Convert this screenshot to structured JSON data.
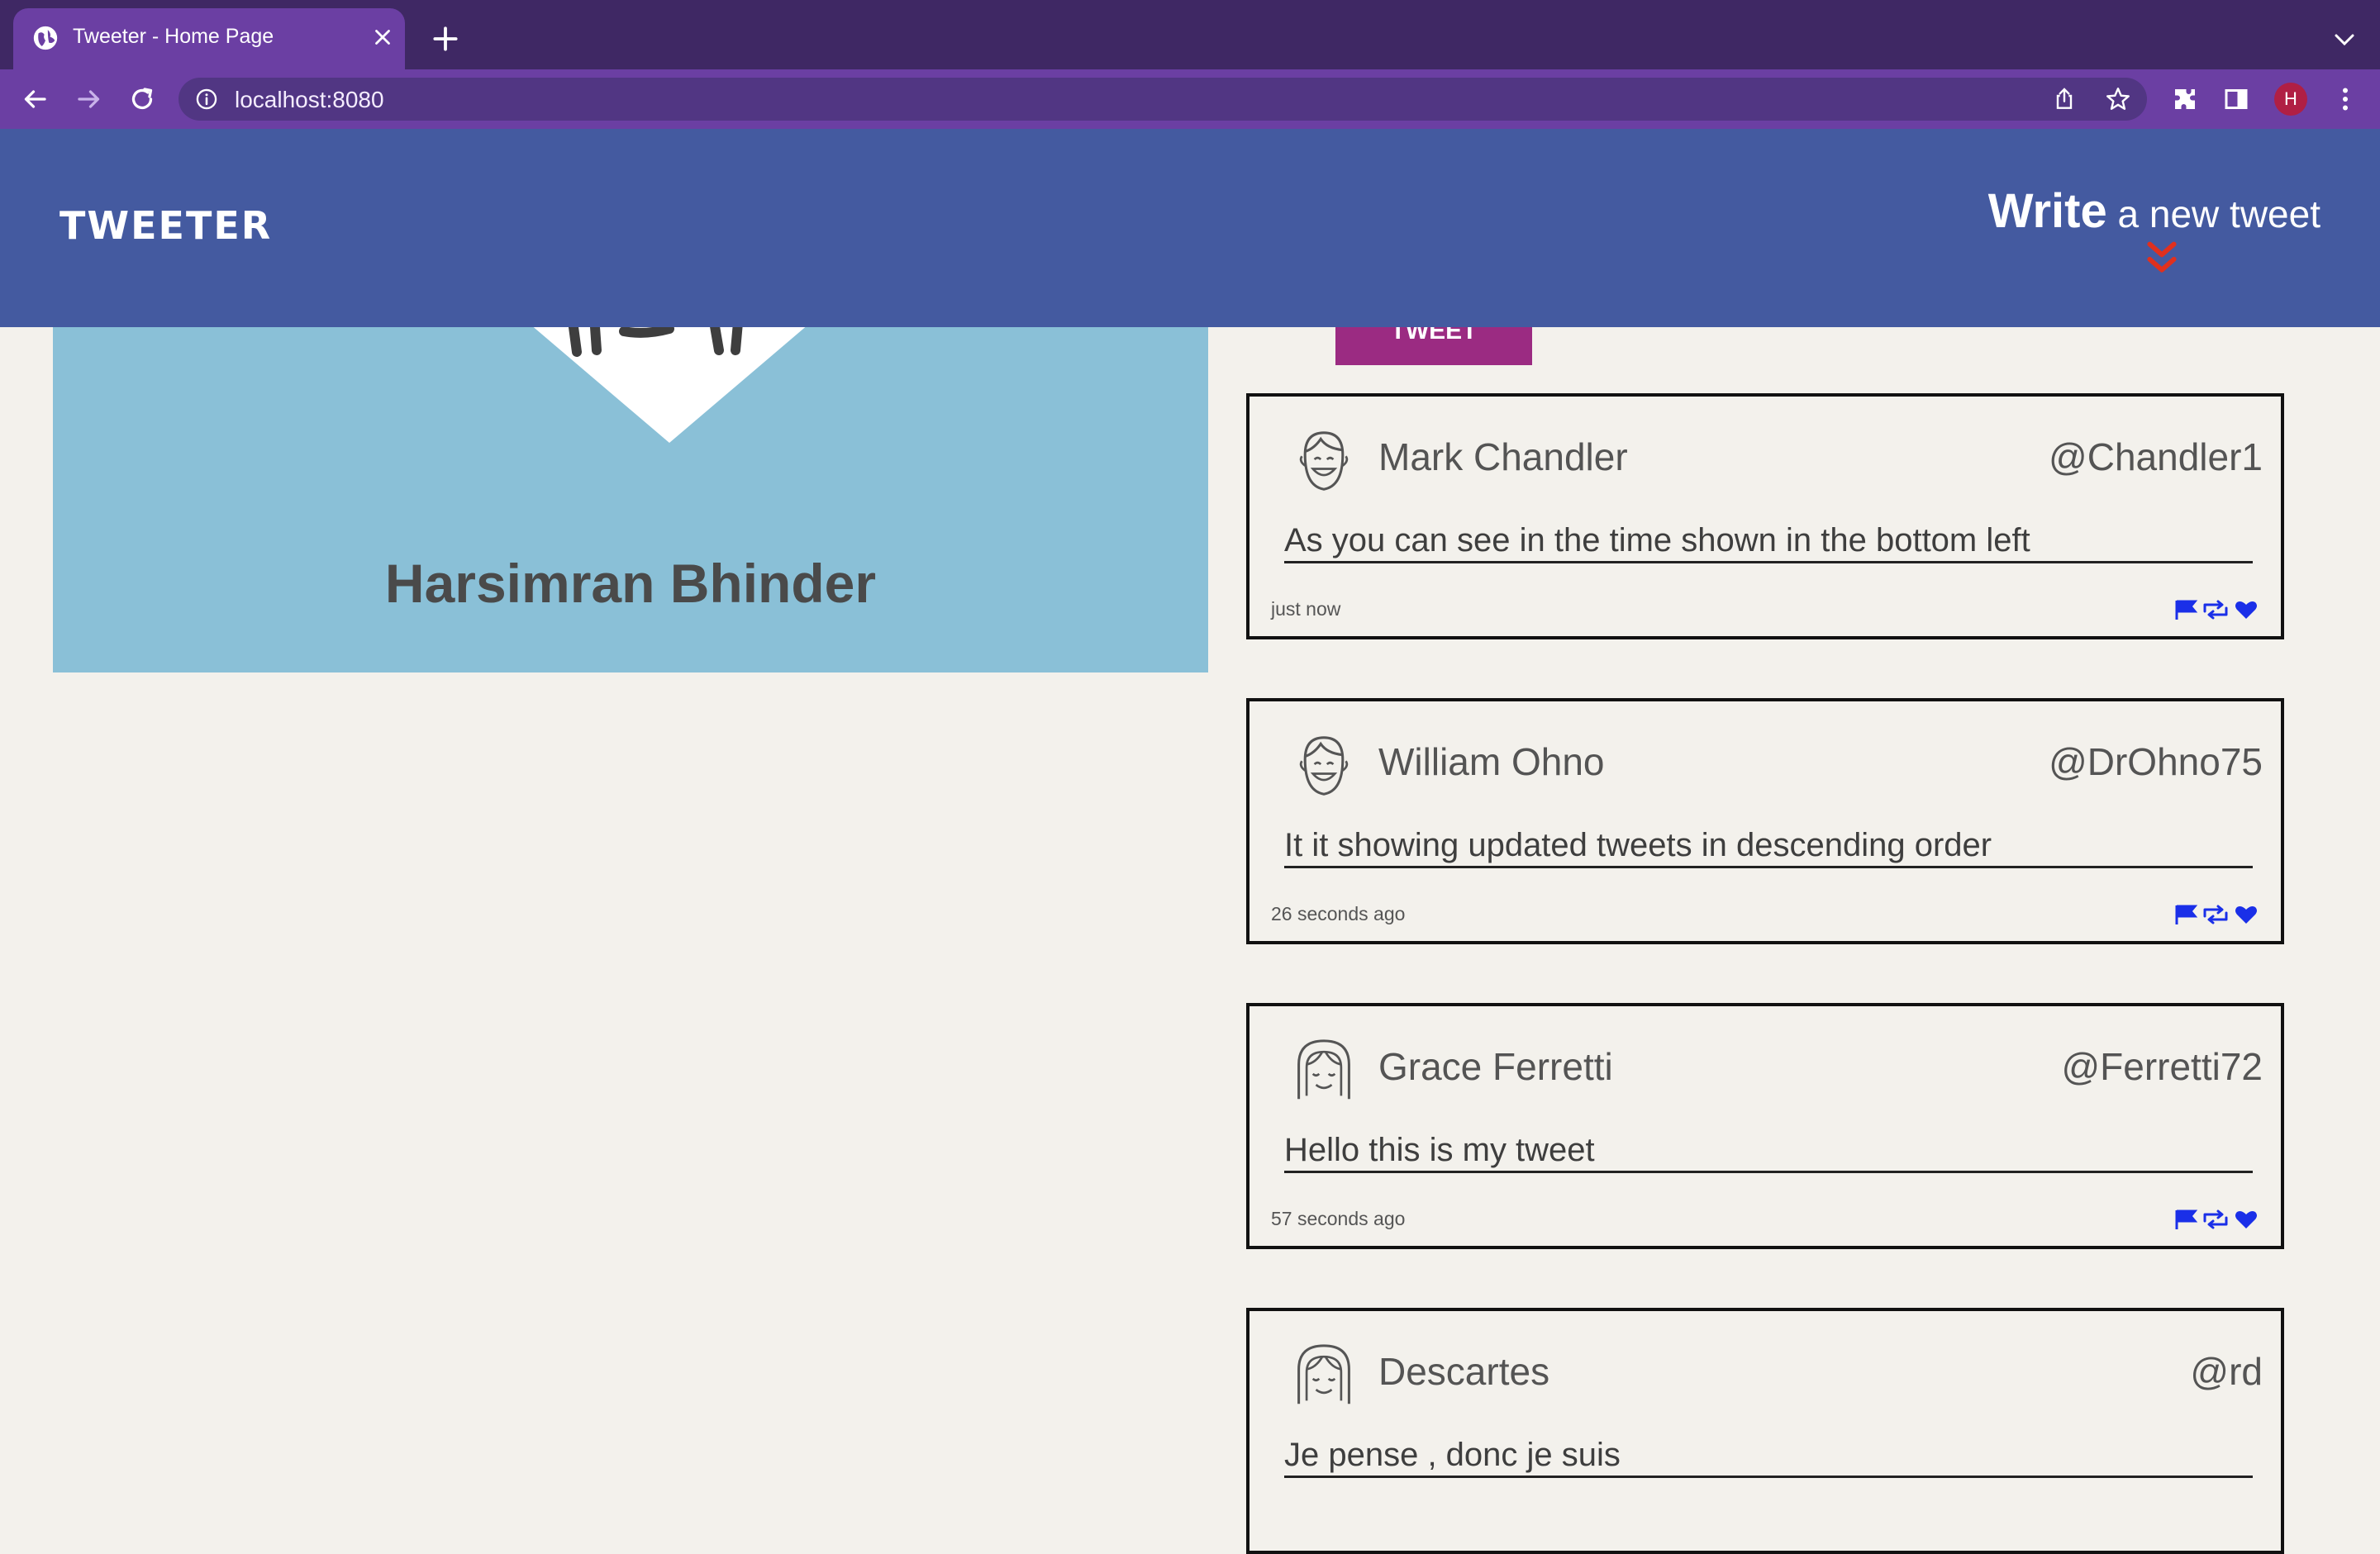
{
  "browser": {
    "tab_title": "Tweeter - Home Page",
    "url": "localhost:8080",
    "profile_initial": "H"
  },
  "site": {
    "logo": "TWEETER",
    "compose_strong": "Write",
    "compose_rest": " a new tweet",
    "tweet_button": "TWEET"
  },
  "profile": {
    "name": "Harsimran Bhinder"
  },
  "tweets": [
    {
      "name": "Mark Chandler",
      "handle": "@Chandler1",
      "text": "As you can see in the time shown in the bottom left",
      "time": "just now",
      "avatar": "male-face-icon"
    },
    {
      "name": "William Ohno",
      "handle": "@DrOhno75",
      "text": "It it showing updated tweets in descending order",
      "time": "26 seconds ago",
      "avatar": "male-face-icon"
    },
    {
      "name": "Grace Ferretti",
      "handle": "@Ferretti72",
      "text": "Hello this is my tweet",
      "time": "57 seconds ago",
      "avatar": "female-face-icon"
    },
    {
      "name": "Descartes",
      "handle": "@rd",
      "text": "Je pense , donc je suis",
      "time": "",
      "avatar": "female-face-icon"
    }
  ],
  "colors": {
    "header": "#445aa0",
    "accent_red": "#e0301e",
    "action_blue": "#1a2fe8",
    "tweet_button": "#9b2b82",
    "profile_card": "#8ac0d7"
  }
}
